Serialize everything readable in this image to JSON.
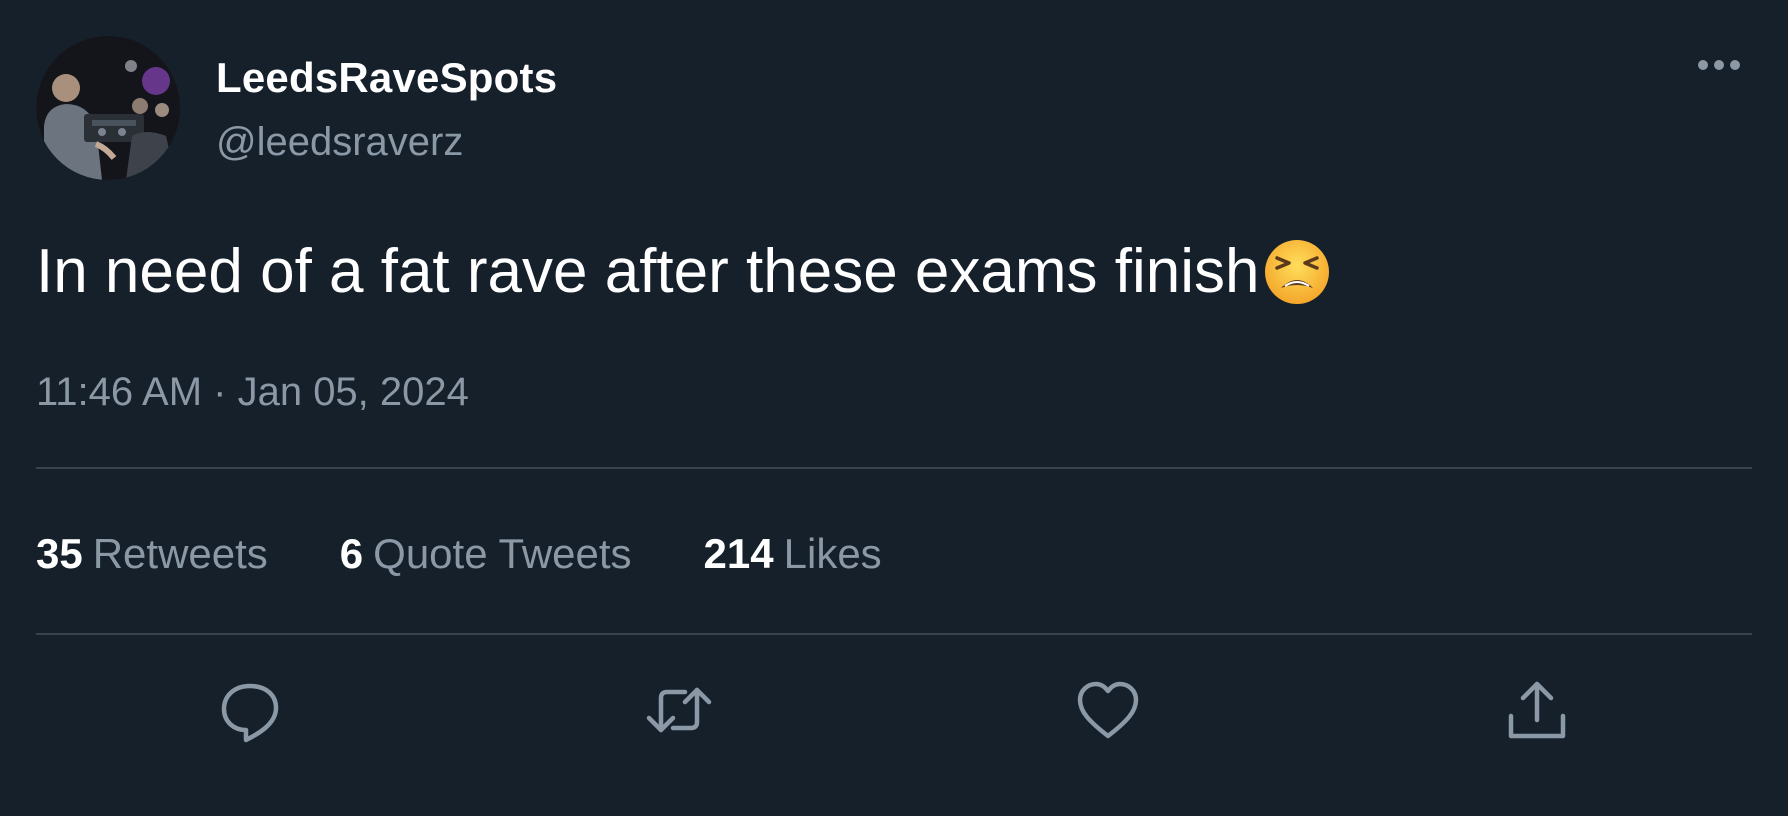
{
  "tweet": {
    "display_name": "LeedsRaveSpots",
    "handle": "@leedsraverz",
    "text": "In need of a fat rave after these exams finish",
    "emoji": "tired-face-emoji",
    "timestamp": "11:46 AM · Jan 05, 2024"
  },
  "stats": {
    "retweets": {
      "count": "35",
      "label": "Retweets"
    },
    "quotes": {
      "count": "6",
      "label": "Quote Tweets"
    },
    "likes": {
      "count": "214",
      "label": "Likes"
    }
  },
  "icons": {
    "more": "more-options-icon",
    "reply": "reply-icon",
    "retweet": "retweet-icon",
    "like": "like-icon",
    "share": "share-icon"
  },
  "colors": {
    "background": "#15202b",
    "primary_text": "#ffffff",
    "secondary_text": "#8b98a5",
    "divider": "#38444d",
    "icon": "#8b98a5"
  }
}
